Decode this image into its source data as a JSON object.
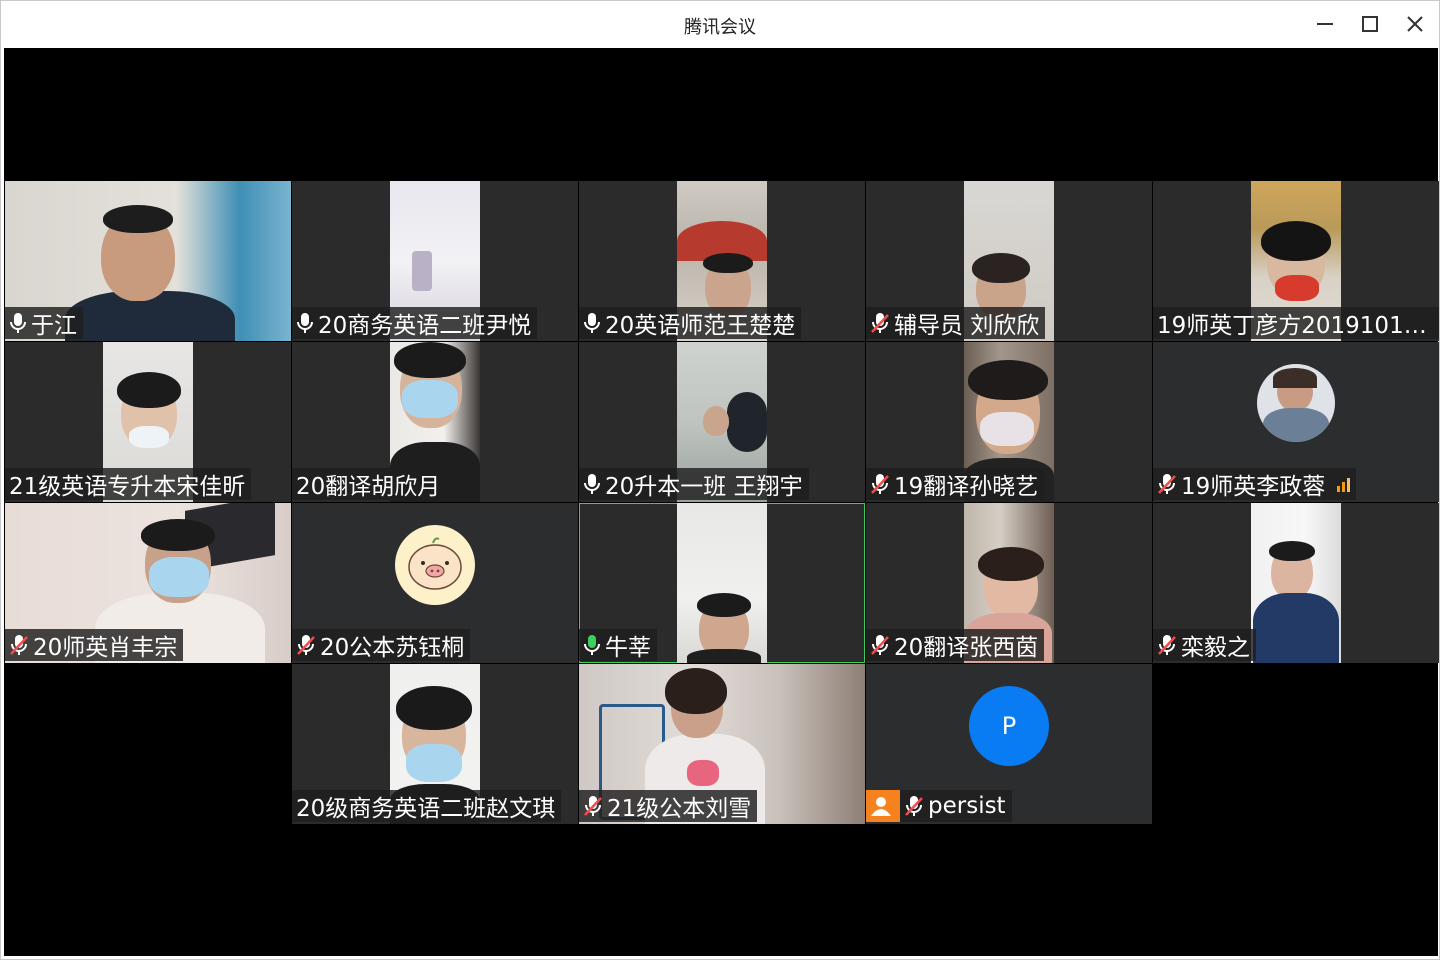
{
  "window": {
    "title": "腾讯会议",
    "controls": [
      "minimize",
      "maximize",
      "close"
    ]
  },
  "participants": [
    {
      "name": "于江",
      "mic": "on",
      "view": "video"
    },
    {
      "name": "20商务英语二班尹悦",
      "mic": "on",
      "view": "video"
    },
    {
      "name": "20英语师范王楚楚",
      "mic": "on",
      "view": "video"
    },
    {
      "name": "辅导员 刘欣欣",
      "mic": "muted",
      "view": "video"
    },
    {
      "name": "19师英丁彦方20191014...",
      "mic": "none",
      "view": "video"
    },
    {
      "name": "21级英语专升本宋佳昕",
      "mic": "none",
      "view": "video"
    },
    {
      "name": "20翻译胡欣月",
      "mic": "none",
      "view": "video"
    },
    {
      "name": "20升本一班 王翔宇",
      "mic": "on",
      "view": "video"
    },
    {
      "name": "19翻译孙晓艺",
      "mic": "muted",
      "view": "video"
    },
    {
      "name": "19师英李政蓉",
      "mic": "muted",
      "view": "avatar",
      "signal": "weak"
    },
    {
      "name": "20师英肖丰宗",
      "mic": "muted",
      "view": "video"
    },
    {
      "name": "20公本苏钰桐",
      "mic": "muted",
      "view": "avatar"
    },
    {
      "name": "牛莘",
      "mic": "speaking",
      "view": "video",
      "active_speaker": true
    },
    {
      "name": "20翻译张西茵",
      "mic": "muted",
      "view": "video"
    },
    {
      "name": "栾毅之",
      "mic": "muted",
      "view": "video"
    },
    {
      "name": "20级商务英语二班赵文琪",
      "mic": "none",
      "view": "video"
    },
    {
      "name": "21级公本刘雪",
      "mic": "muted",
      "view": "video"
    },
    {
      "name": "persist",
      "mic": "muted",
      "view": "avatar",
      "avatar_letter": "P",
      "avatar_color": "#0a7cf3",
      "user_badge_color": "#f5821f"
    }
  ],
  "colors": {
    "stage_bg": "#000000",
    "tile_bg": "#2c2d2f",
    "active_border": "#3ccf5a",
    "muted_icon": "#f24b4b",
    "signal_bars": "#f39c12"
  }
}
